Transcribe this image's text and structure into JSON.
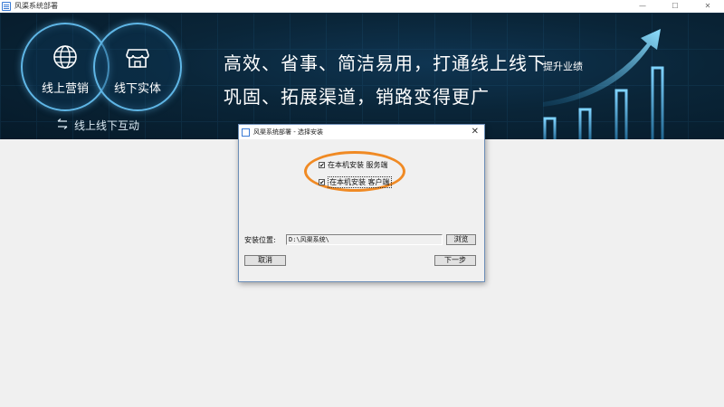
{
  "window": {
    "title": "风渠系统部署",
    "minimize_glyph": "—",
    "maximize_glyph": "☐",
    "close_glyph": "✕"
  },
  "banner": {
    "circle_left_label": "线上营销",
    "circle_right_label": "线下实体",
    "interaction_label": "线上线下互动",
    "slogan_line1": "高效、省事、简洁易用，打通线上线下",
    "slogan_line2": "巩固、拓展渠道，销路变得更广",
    "performance_label": "提升业绩",
    "accent_color": "#5fb6e6",
    "icons": [
      "globe-icon",
      "store-icon",
      "swap-arrows-icon",
      "rising-bars-chart-icon"
    ]
  },
  "dialog": {
    "title": "风渠系统部署 - 选择安装",
    "close_glyph": "✕",
    "options": [
      {
        "label": "在本机安装 服务端",
        "checked": true
      },
      {
        "label": "在本机安装 客户端",
        "checked": true
      }
    ],
    "check_glyph": "✔",
    "install_path_label": "安装位置:",
    "install_path_value": "D:\\风渠系统\\",
    "browse_button": "浏览",
    "cancel_button": "取消",
    "next_button": "下一步",
    "highlight_color": "#f08a24"
  }
}
